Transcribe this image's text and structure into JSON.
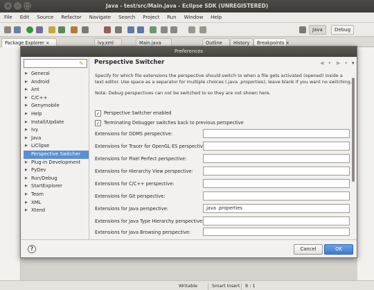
{
  "window": {
    "title": "Java - test/src/Main.java - Eclipse SDK (UNREGISTERED)"
  },
  "menu": [
    "File",
    "Edit",
    "Source",
    "Refactor",
    "Navigate",
    "Search",
    "Project",
    "Run",
    "Window",
    "Help"
  ],
  "perspectives": {
    "java": "Java",
    "debug": "Debug"
  },
  "view_tabs": {
    "package_explorer": "Package Explorer",
    "ivy": "ivy.xml",
    "main": "Main.java",
    "outline": "Outline",
    "history": "History",
    "breakpoints": "Breakpoints"
  },
  "statusbar": {
    "writable": "Writable",
    "insert": "Smart Insert",
    "position": "8 : 1"
  },
  "dialog": {
    "title": "Preferences",
    "filter_value": "",
    "tree": [
      {
        "label": "General",
        "expandable": true
      },
      {
        "label": "Android",
        "expandable": true
      },
      {
        "label": "Ant",
        "expandable": true
      },
      {
        "label": "C/C++",
        "expandable": true
      },
      {
        "label": "Genymobile",
        "expandable": true
      },
      {
        "label": "Help",
        "expandable": true
      },
      {
        "label": "Install/Update",
        "expandable": true
      },
      {
        "label": "Ivy",
        "expandable": true
      },
      {
        "label": "Java",
        "expandable": true
      },
      {
        "label": "LiClipse",
        "expandable": true
      },
      {
        "label": "Perspective Switcher",
        "expandable": false,
        "selected": true
      },
      {
        "label": "Plug-in Development",
        "expandable": true
      },
      {
        "label": "PyDev",
        "expandable": true
      },
      {
        "label": "Run/Debug",
        "expandable": true
      },
      {
        "label": "StartExplorer",
        "expandable": true
      },
      {
        "label": "Team",
        "expandable": true
      },
      {
        "label": "XML",
        "expandable": true
      },
      {
        "label": "Xtend",
        "expandable": true
      }
    ],
    "page": {
      "heading": "Perspective Switcher",
      "description_1": "Specify for which file extensions the perspective should switch to when a file gets activated (opened) inside a text editor. Use space as a separator for multiple choices (.java .properties), leave blank if you want no switching.",
      "note": "Note: Debug perspectives can not be switched to so they are not shown here.",
      "checkboxes": [
        {
          "label": "Perspective Switcher enabled",
          "checked": true
        },
        {
          "label": "Terminating Debugger switches back to previous perspective",
          "checked": true
        }
      ],
      "fields": [
        {
          "label": "Extensions for DDMS perspective:",
          "value": ""
        },
        {
          "label": "Extensions for Tracer for OpenGL ES perspective:",
          "value": ""
        },
        {
          "label": "Extensions for Pixel Perfect perspective:",
          "value": ""
        },
        {
          "label": "Extensions for Hierarchy View perspective:",
          "value": ""
        },
        {
          "label": "Extensions for C/C++ perspective:",
          "value": ""
        },
        {
          "label": "Extensions for Git perspective:",
          "value": ""
        },
        {
          "label": "Extensions for Java perspective:",
          "value": ".java .properties"
        },
        {
          "label": "Extensions for Java Type Hierarchy perspective:",
          "value": ""
        },
        {
          "label": "Extensions for Java Browsing perspective:",
          "value": ""
        }
      ]
    },
    "buttons": {
      "cancel": "Cancel",
      "ok": "OK",
      "help": "?"
    }
  },
  "colors": {
    "selection": "#5a8fd2",
    "ok_button": "#3d7ad0",
    "titlebar": "#3c3b37"
  }
}
